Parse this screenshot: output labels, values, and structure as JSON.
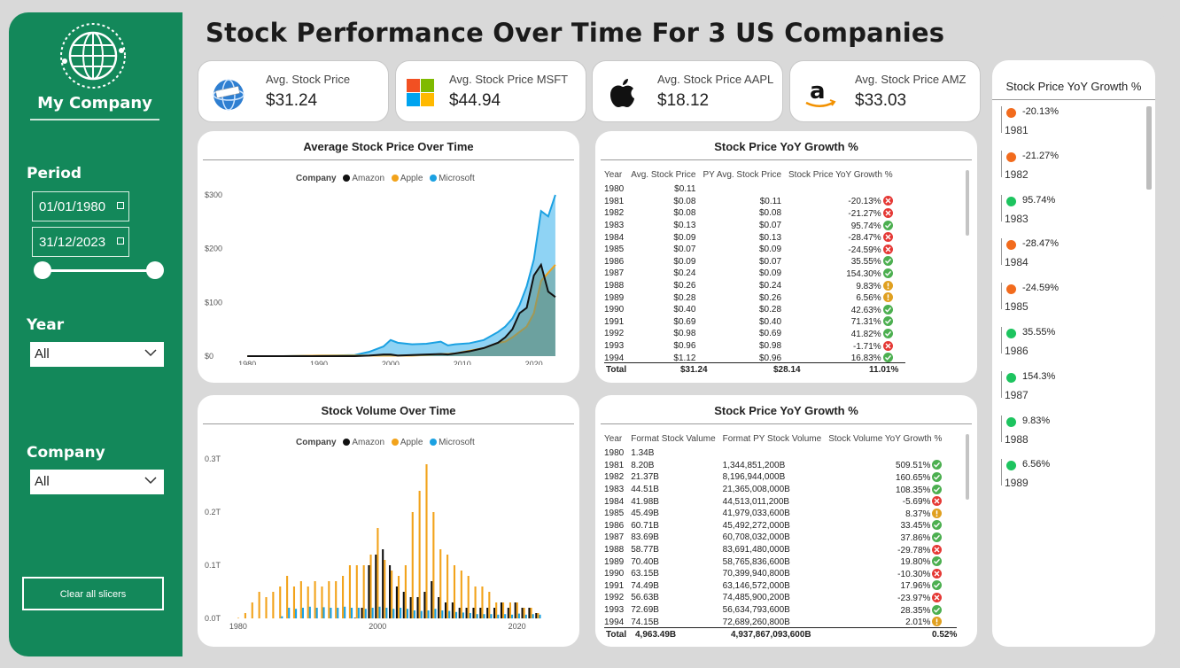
{
  "sidebar": {
    "brand": "My Company",
    "period_label": "Period",
    "start_date": "01/01/1980",
    "end_date": "31/12/2023",
    "year_label": "Year",
    "year_value": "All",
    "company_label": "Company",
    "company_value": "All",
    "clear_label": "Clear all slicers"
  },
  "header": {
    "title": "Stock Performance Over Time For 3 US Companies"
  },
  "kpis": [
    {
      "label": "Avg. Stock Price",
      "value": "$31.24",
      "icon": "globe-icon"
    },
    {
      "label": "Avg. Stock Price MSFT",
      "value": "$44.94",
      "icon": "microsoft-logo-icon"
    },
    {
      "label": "Avg. Stock Price AAPL",
      "value": "$18.12",
      "icon": "apple-logo-icon"
    },
    {
      "label": "Avg. Stock Price AMZ",
      "value": "$33.03",
      "icon": "amazon-logo-icon"
    }
  ],
  "colors": {
    "green": "#13885a",
    "amazon": "#111111",
    "apple": "#f2a31b",
    "microsoft": "#1ba1e2",
    "good": "#4caf50",
    "bad": "#e53935",
    "warn": "#e0a020",
    "orange": "#f26b1d"
  },
  "legend": {
    "title": "Company",
    "items": [
      "Amazon",
      "Apple",
      "Microsoft"
    ]
  },
  "price_table": {
    "title": "Stock Price YoY Growth %",
    "headers": [
      "Year",
      "Avg. Stock Price",
      "PY Avg. Stock Price",
      "Stock Price YoY Growth %"
    ],
    "rows": [
      [
        "1980",
        "$0.11",
        "",
        "",
        ""
      ],
      [
        "1981",
        "$0.08",
        "$0.11",
        "-20.13%",
        "bad"
      ],
      [
        "1982",
        "$0.08",
        "$0.08",
        "-21.27%",
        "bad"
      ],
      [
        "1983",
        "$0.13",
        "$0.07",
        "95.74%",
        "good"
      ],
      [
        "1984",
        "$0.09",
        "$0.13",
        "-28.47%",
        "bad"
      ],
      [
        "1985",
        "$0.07",
        "$0.09",
        "-24.59%",
        "bad"
      ],
      [
        "1986",
        "$0.09",
        "$0.07",
        "35.55%",
        "good"
      ],
      [
        "1987",
        "$0.24",
        "$0.09",
        "154.30%",
        "good"
      ],
      [
        "1988",
        "$0.26",
        "$0.24",
        "9.83%",
        "warn"
      ],
      [
        "1989",
        "$0.28",
        "$0.26",
        "6.56%",
        "warn"
      ],
      [
        "1990",
        "$0.40",
        "$0.28",
        "42.63%",
        "good"
      ],
      [
        "1991",
        "$0.69",
        "$0.40",
        "71.31%",
        "good"
      ],
      [
        "1992",
        "$0.98",
        "$0.69",
        "41.82%",
        "good"
      ],
      [
        "1993",
        "$0.96",
        "$0.98",
        "-1.71%",
        "bad"
      ],
      [
        "1994",
        "$1.12",
        "$0.96",
        "16.83%",
        "good"
      ]
    ],
    "total": [
      "Total",
      "$31.24",
      "$28.14",
      "11.01%"
    ]
  },
  "volume_table": {
    "title": "Stock Price YoY Growth %",
    "headers": [
      "Year",
      "Format Stock Valume",
      "Format PY Stock Volume",
      "Stock Volume YoY Growth %"
    ],
    "rows": [
      [
        "1980",
        "1.34B",
        "",
        "",
        ""
      ],
      [
        "1981",
        "8.20B",
        "1,344,851,200B",
        "509.51%",
        "good"
      ],
      [
        "1982",
        "21.37B",
        "8,196,944,000B",
        "160.65%",
        "good"
      ],
      [
        "1983",
        "44.51B",
        "21,365,008,000B",
        "108.35%",
        "good"
      ],
      [
        "1984",
        "41.98B",
        "44,513,011,200B",
        "-5.69%",
        "bad"
      ],
      [
        "1985",
        "45.49B",
        "41,979,033,600B",
        "8.37%",
        "warn"
      ],
      [
        "1986",
        "60.71B",
        "45,492,272,000B",
        "33.45%",
        "good"
      ],
      [
        "1987",
        "83.69B",
        "60,708,032,000B",
        "37.86%",
        "good"
      ],
      [
        "1988",
        "58.77B",
        "83,691,480,000B",
        "-29.78%",
        "bad"
      ],
      [
        "1989",
        "70.40B",
        "58,765,836,600B",
        "19.80%",
        "good"
      ],
      [
        "1990",
        "63.15B",
        "70,399,940,800B",
        "-10.30%",
        "bad"
      ],
      [
        "1991",
        "74.49B",
        "63,146,572,000B",
        "17.96%",
        "good"
      ],
      [
        "1992",
        "56.63B",
        "74,485,900,200B",
        "-23.97%",
        "bad"
      ],
      [
        "1993",
        "72.69B",
        "56,634,793,600B",
        "28.35%",
        "good"
      ],
      [
        "1994",
        "74.15B",
        "72,689,260,800B",
        "2.01%",
        "warn"
      ]
    ],
    "total": [
      "Total",
      "4,963.49B",
      "4,937,867,093,600B",
      "0.52%"
    ]
  },
  "yoy_list": {
    "title": "Stock Price YoY Growth %",
    "items": [
      {
        "value": "-20.13%",
        "year": "1981",
        "status": "orange"
      },
      {
        "value": "-21.27%",
        "year": "1982",
        "status": "orange"
      },
      {
        "value": "95.74%",
        "year": "1983",
        "status": "good"
      },
      {
        "value": "-28.47%",
        "year": "1984",
        "status": "orange"
      },
      {
        "value": "-24.59%",
        "year": "1985",
        "status": "orange"
      },
      {
        "value": "35.55%",
        "year": "1986",
        "status": "good"
      },
      {
        "value": "154.3%",
        "year": "1987",
        "status": "good"
      },
      {
        "value": "9.83%",
        "year": "1988",
        "status": "good"
      },
      {
        "value": "6.56%",
        "year": "1989",
        "status": "good"
      }
    ]
  },
  "chart_data": [
    {
      "type": "area",
      "title": "Average Stock Price Over Time",
      "x": [
        1980,
        1985,
        1990,
        1995,
        1997,
        1999,
        2000,
        2001,
        2003,
        2005,
        2007,
        2008,
        2009,
        2011,
        2013,
        2015,
        2016,
        2017,
        2018,
        2019,
        2020,
        2021,
        2022,
        2023
      ],
      "x_ticks": [
        "1980",
        "1990",
        "2000",
        "2010",
        "2020"
      ],
      "y_ticks": [
        "$0",
        "$100",
        "$200",
        "$300"
      ],
      "ylim": [
        0,
        300
      ],
      "series": [
        {
          "name": "Microsoft",
          "values": [
            0,
            0,
            1,
            2,
            8,
            18,
            30,
            25,
            22,
            23,
            27,
            20,
            22,
            24,
            30,
            45,
            55,
            70,
            95,
            130,
            180,
            270,
            260,
            300
          ]
        },
        {
          "name": "Apple",
          "values": [
            0,
            0,
            1,
            1,
            1,
            1,
            1,
            1,
            1,
            2,
            4,
            4,
            5,
            10,
            15,
            25,
            27,
            35,
            45,
            55,
            80,
            140,
            155,
            170
          ]
        },
        {
          "name": "Amazon",
          "values": [
            0,
            0,
            0,
            0,
            1,
            3,
            3,
            1,
            2,
            3,
            4,
            3,
            5,
            9,
            15,
            25,
            35,
            50,
            80,
            90,
            150,
            170,
            120,
            110
          ]
        }
      ]
    },
    {
      "type": "bar",
      "title": "Stock Volume Over Time",
      "x_ticks": [
        "1980",
        "2000",
        "2020"
      ],
      "y_ticks": [
        "0.0T",
        "0.1T",
        "0.2T",
        "0.3T"
      ],
      "ylim": [
        0,
        0.3
      ],
      "categories": [
        1980,
        1981,
        1982,
        1983,
        1984,
        1985,
        1986,
        1987,
        1988,
        1989,
        1990,
        1991,
        1992,
        1993,
        1994,
        1995,
        1996,
        1997,
        1998,
        1999,
        2000,
        2001,
        2002,
        2003,
        2004,
        2005,
        2006,
        2007,
        2008,
        2009,
        2010,
        2011,
        2012,
        2013,
        2014,
        2015,
        2016,
        2017,
        2018,
        2019,
        2020,
        2021,
        2022,
        2023
      ],
      "series": [
        {
          "name": "Amazon",
          "values": [
            0,
            0,
            0,
            0,
            0,
            0,
            0,
            0,
            0,
            0,
            0,
            0,
            0,
            0,
            0,
            0,
            0,
            0.001,
            0.02,
            0.1,
            0.12,
            0.13,
            0.1,
            0.06,
            0.05,
            0.04,
            0.04,
            0.05,
            0.07,
            0.04,
            0.03,
            0.03,
            0.02,
            0.02,
            0.02,
            0.02,
            0.02,
            0.02,
            0.03,
            0.02,
            0.03,
            0.02,
            0.02,
            0.01
          ]
        },
        {
          "name": "Apple",
          "values": [
            0.001,
            0.01,
            0.03,
            0.05,
            0.04,
            0.05,
            0.06,
            0.08,
            0.06,
            0.07,
            0.06,
            0.07,
            0.06,
            0.07,
            0.07,
            0.08,
            0.1,
            0.1,
            0.1,
            0.12,
            0.17,
            0.11,
            0.09,
            0.08,
            0.1,
            0.2,
            0.24,
            0.29,
            0.2,
            0.13,
            0.12,
            0.1,
            0.09,
            0.08,
            0.06,
            0.06,
            0.05,
            0.03,
            0.03,
            0.03,
            0.03,
            0.02,
            0.02,
            0.01
          ]
        },
        {
          "name": "Microsoft",
          "values": [
            0,
            0,
            0,
            0,
            0,
            0,
            0.004,
            0.02,
            0.018,
            0.02,
            0.022,
            0.02,
            0.021,
            0.02,
            0.02,
            0.022,
            0.02,
            0.02,
            0.018,
            0.02,
            0.022,
            0.02,
            0.018,
            0.02,
            0.018,
            0.015,
            0.014,
            0.015,
            0.018,
            0.015,
            0.014,
            0.012,
            0.011,
            0.01,
            0.008,
            0.008,
            0.008,
            0.007,
            0.008,
            0.007,
            0.009,
            0.007,
            0.008,
            0.007
          ]
        }
      ]
    }
  ]
}
